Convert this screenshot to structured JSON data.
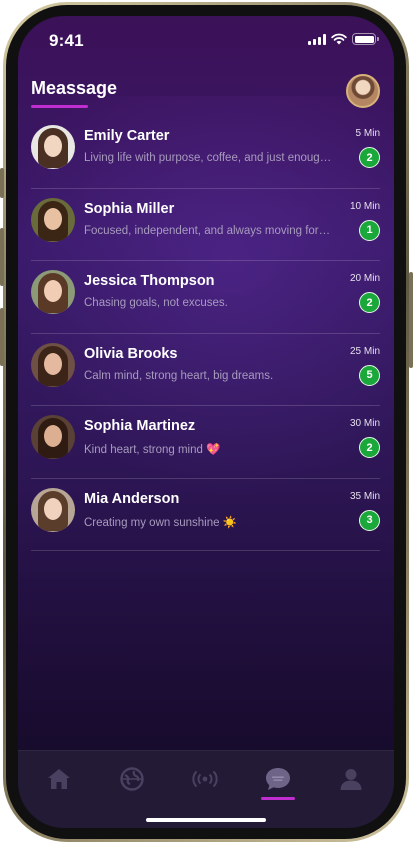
{
  "status_bar": {
    "time": "9:41"
  },
  "header": {
    "title": "Meassage"
  },
  "messages": [
    {
      "name": "Emily Carter",
      "preview": "Living life with purpose, coffee, and just enough chaos",
      "time": "5 Min",
      "unread": "2"
    },
    {
      "name": "Sophia Miller",
      "preview": "Focused, independent, and always moving forward",
      "time": "10 Min",
      "unread": "1"
    },
    {
      "name": "Jessica Thompson",
      "preview": "Chasing goals, not excuses.",
      "time": "20 Min",
      "unread": "2"
    },
    {
      "name": "Olivia Brooks",
      "preview": "Calm mind, strong heart, big dreams.",
      "time": "25 Min",
      "unread": "5"
    },
    {
      "name": "Sophia Martinez",
      "preview": "Kind heart, strong mind 💖",
      "time": "30 Min",
      "unread": "2"
    },
    {
      "name": "Mia Anderson",
      "preview": "Creating my own sunshine ☀️",
      "time": "35 Min",
      "unread": "3"
    }
  ],
  "nav": {
    "items": [
      {
        "icon": "home-icon",
        "active": false
      },
      {
        "icon": "globe-icon",
        "active": false
      },
      {
        "icon": "live-broadcast-icon",
        "active": false
      },
      {
        "icon": "chat-bubble-icon",
        "active": true
      },
      {
        "icon": "profile-icon",
        "active": false
      }
    ]
  },
  "colors": {
    "accent": "#c02ecf",
    "badge": "#1ba83a",
    "background_top": "#3b1158",
    "background_bottom": "#130a24",
    "nav_background": "#231a35"
  }
}
